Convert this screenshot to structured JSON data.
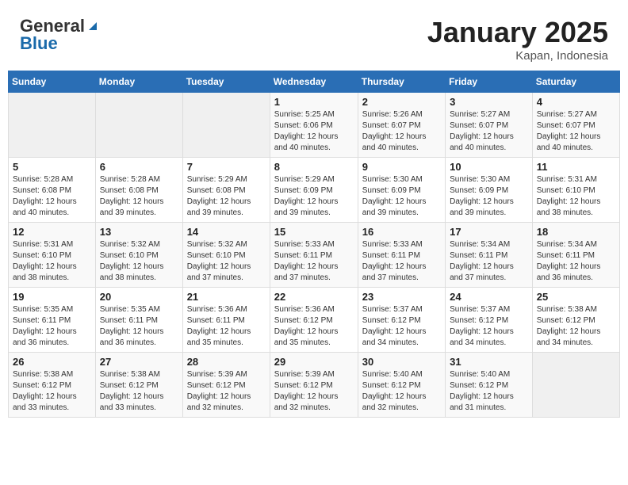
{
  "header": {
    "logo_general": "General",
    "logo_blue": "Blue",
    "month_title": "January 2025",
    "location": "Kapan, Indonesia"
  },
  "days_of_week": [
    "Sunday",
    "Monday",
    "Tuesday",
    "Wednesday",
    "Thursday",
    "Friday",
    "Saturday"
  ],
  "weeks": [
    [
      {
        "day": "",
        "info": ""
      },
      {
        "day": "",
        "info": ""
      },
      {
        "day": "",
        "info": ""
      },
      {
        "day": "1",
        "info": "Sunrise: 5:25 AM\nSunset: 6:06 PM\nDaylight: 12 hours\nand 40 minutes."
      },
      {
        "day": "2",
        "info": "Sunrise: 5:26 AM\nSunset: 6:07 PM\nDaylight: 12 hours\nand 40 minutes."
      },
      {
        "day": "3",
        "info": "Sunrise: 5:27 AM\nSunset: 6:07 PM\nDaylight: 12 hours\nand 40 minutes."
      },
      {
        "day": "4",
        "info": "Sunrise: 5:27 AM\nSunset: 6:07 PM\nDaylight: 12 hours\nand 40 minutes."
      }
    ],
    [
      {
        "day": "5",
        "info": "Sunrise: 5:28 AM\nSunset: 6:08 PM\nDaylight: 12 hours\nand 40 minutes."
      },
      {
        "day": "6",
        "info": "Sunrise: 5:28 AM\nSunset: 6:08 PM\nDaylight: 12 hours\nand 39 minutes."
      },
      {
        "day": "7",
        "info": "Sunrise: 5:29 AM\nSunset: 6:08 PM\nDaylight: 12 hours\nand 39 minutes."
      },
      {
        "day": "8",
        "info": "Sunrise: 5:29 AM\nSunset: 6:09 PM\nDaylight: 12 hours\nand 39 minutes."
      },
      {
        "day": "9",
        "info": "Sunrise: 5:30 AM\nSunset: 6:09 PM\nDaylight: 12 hours\nand 39 minutes."
      },
      {
        "day": "10",
        "info": "Sunrise: 5:30 AM\nSunset: 6:09 PM\nDaylight: 12 hours\nand 39 minutes."
      },
      {
        "day": "11",
        "info": "Sunrise: 5:31 AM\nSunset: 6:10 PM\nDaylight: 12 hours\nand 38 minutes."
      }
    ],
    [
      {
        "day": "12",
        "info": "Sunrise: 5:31 AM\nSunset: 6:10 PM\nDaylight: 12 hours\nand 38 minutes."
      },
      {
        "day": "13",
        "info": "Sunrise: 5:32 AM\nSunset: 6:10 PM\nDaylight: 12 hours\nand 38 minutes."
      },
      {
        "day": "14",
        "info": "Sunrise: 5:32 AM\nSunset: 6:10 PM\nDaylight: 12 hours\nand 37 minutes."
      },
      {
        "day": "15",
        "info": "Sunrise: 5:33 AM\nSunset: 6:11 PM\nDaylight: 12 hours\nand 37 minutes."
      },
      {
        "day": "16",
        "info": "Sunrise: 5:33 AM\nSunset: 6:11 PM\nDaylight: 12 hours\nand 37 minutes."
      },
      {
        "day": "17",
        "info": "Sunrise: 5:34 AM\nSunset: 6:11 PM\nDaylight: 12 hours\nand 37 minutes."
      },
      {
        "day": "18",
        "info": "Sunrise: 5:34 AM\nSunset: 6:11 PM\nDaylight: 12 hours\nand 36 minutes."
      }
    ],
    [
      {
        "day": "19",
        "info": "Sunrise: 5:35 AM\nSunset: 6:11 PM\nDaylight: 12 hours\nand 36 minutes."
      },
      {
        "day": "20",
        "info": "Sunrise: 5:35 AM\nSunset: 6:11 PM\nDaylight: 12 hours\nand 36 minutes."
      },
      {
        "day": "21",
        "info": "Sunrise: 5:36 AM\nSunset: 6:11 PM\nDaylight: 12 hours\nand 35 minutes."
      },
      {
        "day": "22",
        "info": "Sunrise: 5:36 AM\nSunset: 6:12 PM\nDaylight: 12 hours\nand 35 minutes."
      },
      {
        "day": "23",
        "info": "Sunrise: 5:37 AM\nSunset: 6:12 PM\nDaylight: 12 hours\nand 34 minutes."
      },
      {
        "day": "24",
        "info": "Sunrise: 5:37 AM\nSunset: 6:12 PM\nDaylight: 12 hours\nand 34 minutes."
      },
      {
        "day": "25",
        "info": "Sunrise: 5:38 AM\nSunset: 6:12 PM\nDaylight: 12 hours\nand 34 minutes."
      }
    ],
    [
      {
        "day": "26",
        "info": "Sunrise: 5:38 AM\nSunset: 6:12 PM\nDaylight: 12 hours\nand 33 minutes."
      },
      {
        "day": "27",
        "info": "Sunrise: 5:38 AM\nSunset: 6:12 PM\nDaylight: 12 hours\nand 33 minutes."
      },
      {
        "day": "28",
        "info": "Sunrise: 5:39 AM\nSunset: 6:12 PM\nDaylight: 12 hours\nand 32 minutes."
      },
      {
        "day": "29",
        "info": "Sunrise: 5:39 AM\nSunset: 6:12 PM\nDaylight: 12 hours\nand 32 minutes."
      },
      {
        "day": "30",
        "info": "Sunrise: 5:40 AM\nSunset: 6:12 PM\nDaylight: 12 hours\nand 32 minutes."
      },
      {
        "day": "31",
        "info": "Sunrise: 5:40 AM\nSunset: 6:12 PM\nDaylight: 12 hours\nand 31 minutes."
      },
      {
        "day": "",
        "info": ""
      }
    ]
  ]
}
